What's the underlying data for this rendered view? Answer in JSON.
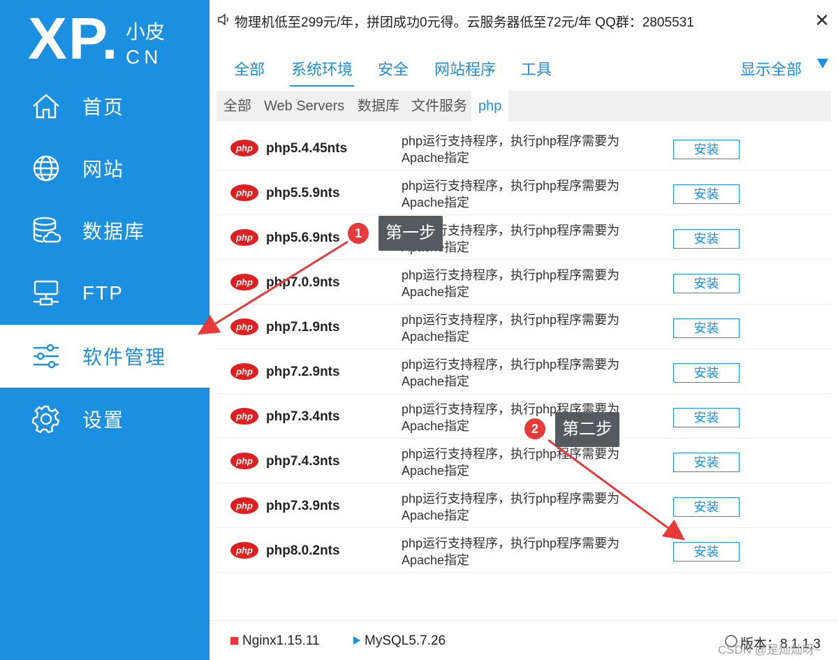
{
  "logo": {
    "main": "XP.",
    "cn_top": "小皮",
    "cn_bottom": "CN"
  },
  "sidebar": {
    "items": [
      {
        "label": "首页",
        "icon": "home-icon",
        "active": false
      },
      {
        "label": "网站",
        "icon": "globe-icon",
        "active": false
      },
      {
        "label": "数据库",
        "icon": "database-icon",
        "active": false
      },
      {
        "label": "FTP",
        "icon": "ftp-server-icon",
        "active": false
      },
      {
        "label": "软件管理",
        "icon": "sliders-icon",
        "active": true
      },
      {
        "label": "设置",
        "icon": "gear-icon",
        "active": false
      }
    ]
  },
  "notice": {
    "text": "物理机低至299元/年，拼团成功0元得。云服务器低至72元/年  QQ群：2805531",
    "close": "✕"
  },
  "tabs": {
    "items": [
      "全部",
      "系统环境",
      "安全",
      "网站程序",
      "工具"
    ],
    "active_index": 1,
    "show_all": "显示全部"
  },
  "subtabs": {
    "items": [
      "全部",
      "Web Servers",
      "数据库",
      "文件服务",
      "php"
    ],
    "active_index": 4
  },
  "packages": [
    {
      "name": "php5.4.45nts",
      "desc": "php运行支持程序，执行php程序需要为Apache指定",
      "button": "安装"
    },
    {
      "name": "php5.5.9nts",
      "desc": "php运行支持程序，执行php程序需要为Apache指定",
      "button": "安装"
    },
    {
      "name": "php5.6.9nts",
      "desc": "php运行支持程序，执行php程序需要为Apache指定",
      "button": "安装"
    },
    {
      "name": "php7.0.9nts",
      "desc": "php运行支持程序，执行php程序需要为Apache指定",
      "button": "安装"
    },
    {
      "name": "php7.1.9nts",
      "desc": "php运行支持程序，执行php程序需要为Apache指定",
      "button": "安装"
    },
    {
      "name": "php7.2.9nts",
      "desc": "php运行支持程序，执行php程序需要为Apache指定",
      "button": "安装"
    },
    {
      "name": "php7.3.4nts",
      "desc": "php运行支持程序，执行php程序需要为Apache指定",
      "button": "安装"
    },
    {
      "name": "php7.4.3nts",
      "desc": "php运行支持程序，执行php程序需要为Apache指定",
      "button": "安装"
    },
    {
      "name": "php7.3.9nts",
      "desc": "php运行支持程序，执行php程序需要为Apache指定",
      "button": "安装"
    },
    {
      "name": "php8.0.2nts",
      "desc": "php运行支持程序，执行php程序需要为Apache指定",
      "button": "安装"
    }
  ],
  "php_logo_text": "php",
  "annotations": [
    {
      "number": "1",
      "label": "第一步"
    },
    {
      "number": "2",
      "label": "第二步"
    }
  ],
  "status": {
    "nginx": "Nginx1.15.11",
    "mysql": "MySQL5.7.26",
    "version": "版本：8.1.1.3"
  },
  "watermark": "CSDN @是灿灿呀~",
  "colors": {
    "accent": "#1b8fe0",
    "annotation_red": "#e83a3a",
    "annotation_label_bg": "#555a5e",
    "php_logo_red": "#e02020"
  }
}
